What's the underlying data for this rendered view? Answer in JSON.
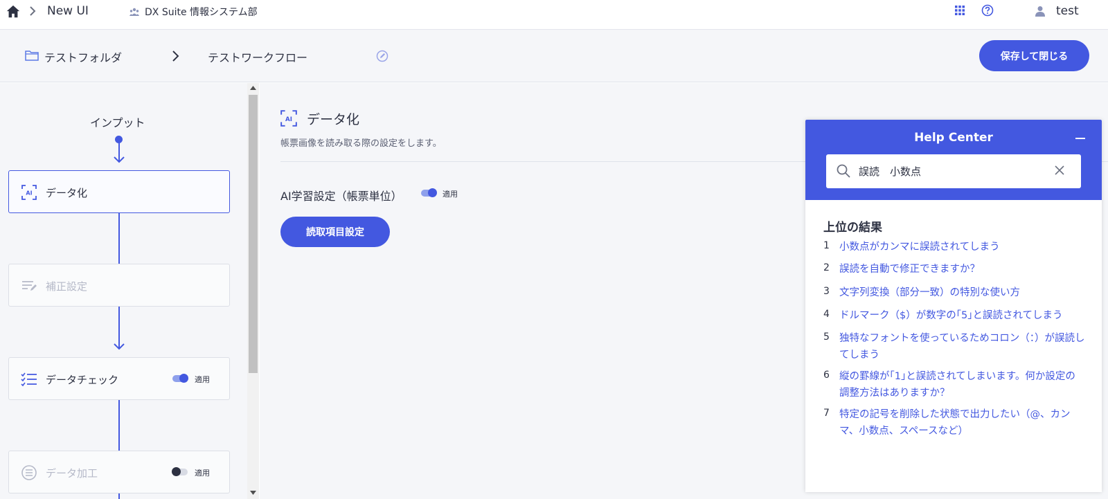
{
  "topnav": {
    "app_title": "New UI",
    "org_name": "DX Suite 情報システム部",
    "user_name": "test"
  },
  "breadcrumb": {
    "folder": "テストフォルダ",
    "workflow": "テストワークフロー",
    "save_button": "保存して閉じる"
  },
  "workflow": {
    "input_label": "インプット",
    "steps": [
      {
        "label": "データ化",
        "state": "active"
      },
      {
        "label": "補正設定",
        "state": "disabled"
      },
      {
        "label": "データチェック",
        "toggle_label": "適用",
        "toggle_on": true
      },
      {
        "label": "データ加工",
        "toggle_label": "適用",
        "toggle_on": false,
        "state": "disabled"
      }
    ]
  },
  "main": {
    "title": "データ化",
    "description": "帳票画像を読み取る際の設定をします。",
    "ai_setting_label": "AI学習設定（帳票単位）",
    "ai_toggle_label": "適用",
    "ai_toggle_on": true,
    "read_items_button": "読取項目設定"
  },
  "help_center": {
    "title": "Help Center",
    "search_value": "誤読　小数点",
    "results_heading": "上位の結果",
    "results": [
      {
        "num": "1",
        "text": "小数点がカンマに誤読されてしまう"
      },
      {
        "num": "2",
        "text": "誤読を自動で修正できますか？"
      },
      {
        "num": "3",
        "text": "文字列変換（部分一致）の特別な使い方"
      },
      {
        "num": "4",
        "text": "ドルマーク（$）が数字の｢5｣と誤読されてしまう"
      },
      {
        "num": "5",
        "text": "独特なフォントを使っているためコロン（：）が誤読してしまう"
      },
      {
        "num": "6",
        "text": "縦の罫線が｢1｣と誤読されてしまいます。何か設定の調整方法はありますか？"
      },
      {
        "num": "7",
        "text": "特定の記号を削除した状態で出力したい（@、カンマ、小数点、スペースなど）"
      }
    ]
  },
  "colors": {
    "accent": "#4358e0",
    "panel_bg": "#f5f6f9",
    "text": "#2d3142",
    "disabled_text": "#b5b9c8"
  },
  "icons": [
    "home-icon",
    "chevron-right-icon",
    "org-icon",
    "apps-grid-icon",
    "help-icon",
    "user-icon",
    "folder-icon",
    "edit-icon",
    "ai-icon",
    "correction-icon",
    "checklist-icon",
    "process-icon",
    "search-icon",
    "clear-icon",
    "minimize-icon"
  ]
}
